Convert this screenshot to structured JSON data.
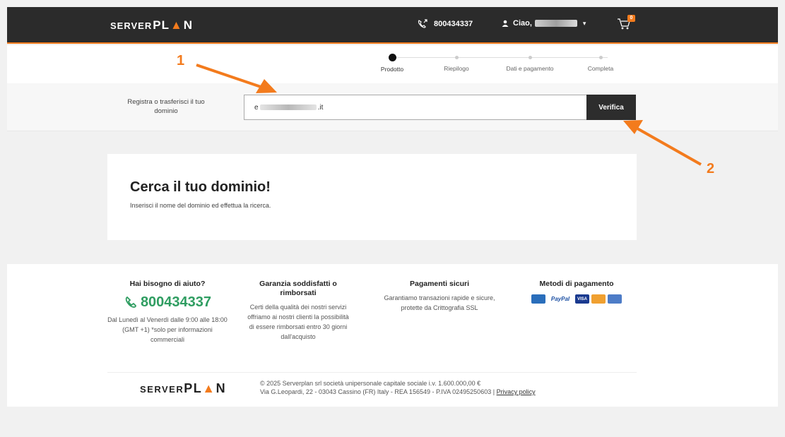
{
  "header": {
    "logo_part1": "SERVER",
    "logo_part2": "PL",
    "logo_part3": "N",
    "phone": "800434337",
    "greeting": "Ciao,",
    "cart_count": "0"
  },
  "steps": [
    {
      "label": "Prodotto",
      "active": true
    },
    {
      "label": "Riepilogo",
      "active": false
    },
    {
      "label": "Dati e pagamento",
      "active": false
    },
    {
      "label": "Completa",
      "active": false
    }
  ],
  "search": {
    "label": "Registra o trasferisci il tuo dominio",
    "value_prefix": "e",
    "value_suffix": ".it",
    "button": "Verifica"
  },
  "card": {
    "title": "Cerca il tuo dominio!",
    "subtitle": "Inserisci il nome del dominio ed effettua la ricerca."
  },
  "footer": {
    "help": {
      "title": "Hai bisogno di aiuto?",
      "phone": "800434337",
      "text": "Dal Lunedì al Venerdì dalle 9:00 alle 18:00 (GMT +1) *solo per informazioni commerciali"
    },
    "guarantee": {
      "title": "Garanzia soddisfatti o rimborsati",
      "text": "Certi della qualità dei nostri servizi offriamo ai nostri clienti la possibilità di essere rimborsati entro 30 giorni dall'acquisto"
    },
    "secure": {
      "title": "Pagamenti sicuri",
      "text": "Garantiamo transazioni rapide e sicure, protette da Crittografia SSL"
    },
    "methods": {
      "title": "Metodi di pagamento",
      "icons": [
        "amex-icon",
        "paypal-icon",
        "visa-icon",
        "mastercard-icon",
        "bank-icon"
      ]
    },
    "legal_line1": "© 2025 Serverplan srl società unipersonale capitale sociale i.v. 1.600.000,00 €",
    "legal_line2": "Via G.Leopardi, 22 - 03043 Cassino (FR) Italy - REA 156549 - P.IVA 02495250603",
    "privacy": "Privacy policy"
  },
  "annotations": {
    "one": "1",
    "two": "2"
  },
  "colors": {
    "accent": "#f37b1d",
    "header_bg": "#2b2b2b",
    "phone_green": "#2f9d61"
  }
}
